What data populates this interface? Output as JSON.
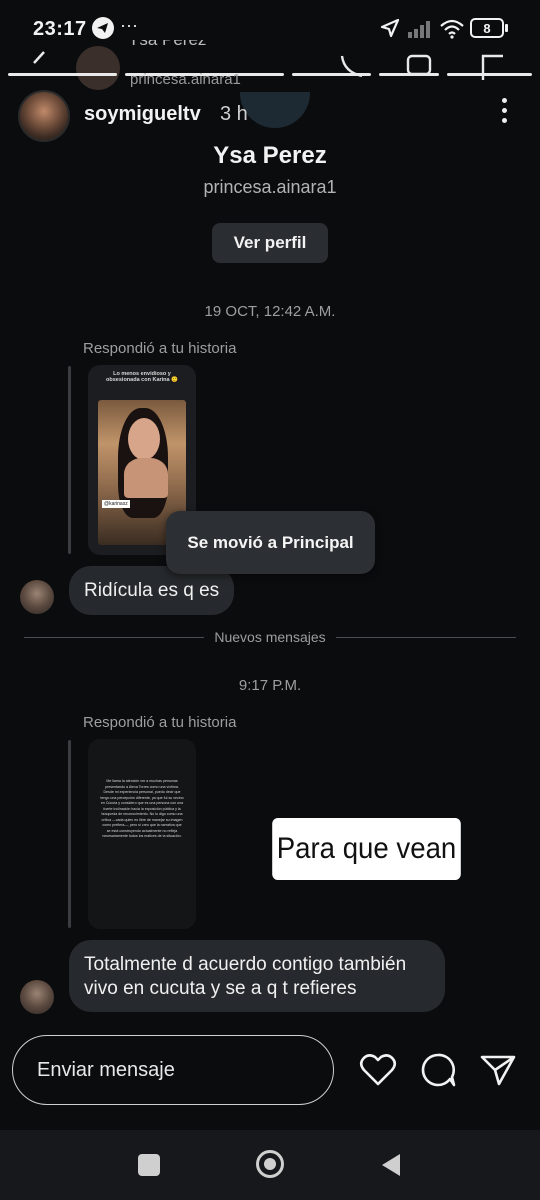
{
  "status_bar": {
    "time": "23:17",
    "dots": "···",
    "battery": "8"
  },
  "header": {
    "name": "Ysa Perez",
    "username": "princesa.ainara1"
  },
  "overlay": {
    "username": "soymigueltv",
    "time": "3 h"
  },
  "profile": {
    "name": "Ysa Perez",
    "username": "princesa.ainara1",
    "view_button": "Ver perfil"
  },
  "conversation": {
    "date1": "19 OCT, 12:42 A.M.",
    "reply1_label": "Respondió a tu historia",
    "story1_caption": "Lo menos envidioso y obsesionada con Karina 🙂",
    "story1_tag": "@karinasz",
    "message1": "Ridícula es q es",
    "toast": "Se movió a Principal",
    "new_messages": "Nuevos mensajes",
    "date2": "9:17 P.M.",
    "reply2_label": "Respondió a tu historia",
    "story2_text": "Me llama la atención ver a muchas personas presentando a Alexa Torres como una víctima.  Desde mi experiencia personal, puedo decir que tengo una percepción diferente, ya que fui su vecino en Cúcuta y considero que es una persona con una fuerte inclinación hacia la exposición pública y la búsqueda de reconocimiento.  No lo digo como una crítica —cada quien es libre de manejar su imagen como prefiera—, pero sí creo que la narrativa que se está construyendo actualmente no refleja necesariamente todos los matices de la situación.",
    "sticker": "Para que vean",
    "message2": "Totalmente d acuerdo contigo también vivo en cucuta y se a q t refieres"
  },
  "composer": {
    "placeholder": "Enviar mensaje"
  },
  "icons": {
    "heart": "heart-icon",
    "sticker": "sticker-icon",
    "send": "send-icon",
    "call": "phone-icon",
    "video": "video-icon",
    "flag": "flag-icon"
  }
}
